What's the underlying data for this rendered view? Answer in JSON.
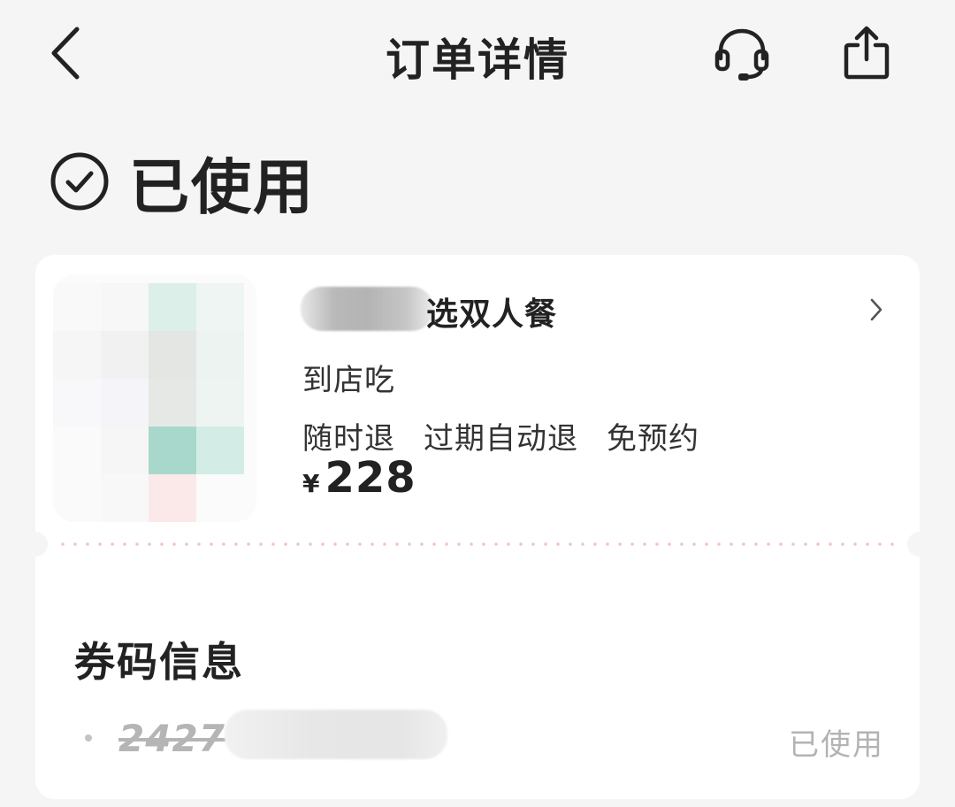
{
  "header": {
    "title": "订单详情",
    "back_icon": "chevron-left-icon",
    "service_icon": "headset-icon",
    "share_icon": "share-icon"
  },
  "status": {
    "icon": "check-circle-icon",
    "text": "已使用"
  },
  "product": {
    "name": "选双人餐",
    "dine_mode": "到店吃",
    "tags": [
      "随时退",
      "过期自动退",
      "免预约"
    ],
    "currency": "¥",
    "price": "228"
  },
  "coupon": {
    "section_title": "券码信息",
    "code": "2427",
    "status": "已使用"
  },
  "colors": {
    "background": "#f5f5f5",
    "card": "#ffffff",
    "text_primary": "#222222",
    "text_muted": "#b3b3b3",
    "divider_dots": "#f4c4c0"
  }
}
